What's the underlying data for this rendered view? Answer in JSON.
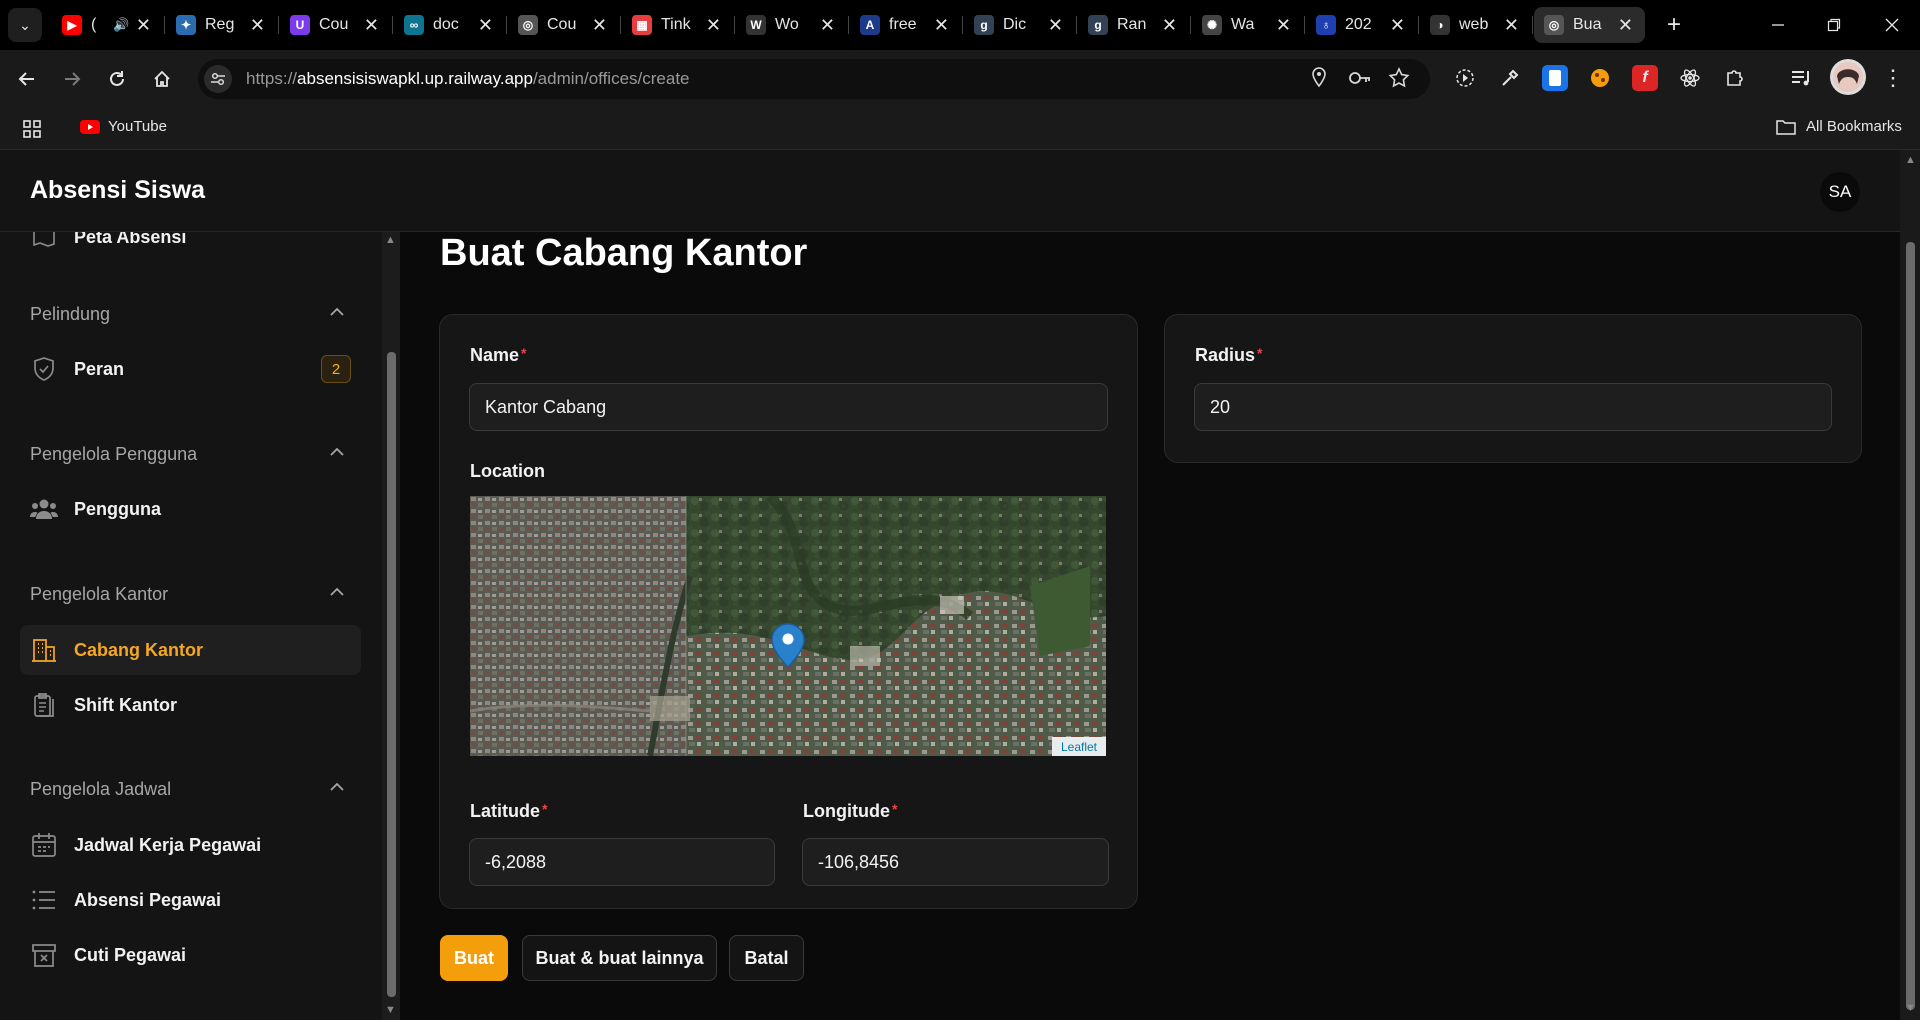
{
  "browser": {
    "tabs": [
      {
        "title": "(",
        "favicon": "youtube-icon",
        "color": "#ff0000",
        "glyph": "▶",
        "muted_audio": true
      },
      {
        "title": "Reg",
        "favicon": "puzzle-icon",
        "color": "#2b6cb0",
        "glyph": "✦"
      },
      {
        "title": "Cou",
        "favicon": "u-icon",
        "color": "#7c3aed",
        "glyph": "U"
      },
      {
        "title": "doc",
        "favicon": "infinity-icon",
        "color": "#0e7490",
        "glyph": "∞"
      },
      {
        "title": "Cou",
        "favicon": "globe-icon",
        "color": "#555555",
        "glyph": "◎"
      },
      {
        "title": "Tink",
        "favicon": "tinkercad-icon",
        "color": "#e53e3e",
        "glyph": "▦"
      },
      {
        "title": "Wo",
        "favicon": "w-icon",
        "color": "#333333",
        "glyph": "W"
      },
      {
        "title": "free",
        "favicon": "a-icon",
        "color": "#1e3a8a",
        "glyph": "A"
      },
      {
        "title": "Dic",
        "favicon": "g-icon",
        "color": "#334155",
        "glyph": "g"
      },
      {
        "title": "Ran",
        "favicon": "g-icon",
        "color": "#334155",
        "glyph": "g"
      },
      {
        "title": "Wa",
        "favicon": "openai-icon",
        "color": "#444444",
        "glyph": "✺"
      },
      {
        "title": "202",
        "favicon": "location-icon",
        "color": "#1e40af",
        "glyph": "♁"
      },
      {
        "title": "web",
        "favicon": "web-icon",
        "color": "#333333",
        "glyph": "◑"
      },
      {
        "title": "Bua",
        "favicon": "globe-icon",
        "color": "#555555",
        "glyph": "◎",
        "active": true
      }
    ],
    "close_glyph": "✕",
    "new_tab": "+",
    "url_prefix": "https://",
    "url_host": "absensisiswapkl.up.railway.app",
    "url_path": "/admin/offices/create",
    "bookmarks": [
      {
        "label": "YouTube",
        "icon": "youtube-icon"
      }
    ],
    "all_bookmarks": "All Bookmarks"
  },
  "app": {
    "brand": "Absensi Siswa",
    "user_initials": "SA"
  },
  "sidebar": {
    "partial_item": "Peta Absensi",
    "groups": [
      {
        "label": "Pelindung",
        "items": [
          {
            "label": "Peran",
            "icon": "shield-check-icon",
            "badge": "2"
          }
        ]
      },
      {
        "label": "Pengelola Pengguna",
        "items": [
          {
            "label": "Pengguna",
            "icon": "users-icon"
          }
        ]
      },
      {
        "label": "Pengelola Kantor",
        "items": [
          {
            "label": "Cabang Kantor",
            "icon": "building-icon",
            "active": true
          },
          {
            "label": "Shift Kantor",
            "icon": "clipboard-icon"
          }
        ]
      },
      {
        "label": "Pengelola Jadwal",
        "items": [
          {
            "label": "Jadwal Kerja Pegawai",
            "icon": "calendar-icon"
          },
          {
            "label": "Absensi Pegawai",
            "icon": "list-icon"
          },
          {
            "label": "Cuti Pegawai",
            "icon": "archive-x-icon"
          }
        ]
      }
    ]
  },
  "form": {
    "title": "Buat Cabang Kantor",
    "name_label": "Name",
    "name_value": "Kantor Cabang",
    "location_label": "Location",
    "map_attribution": "Leaflet",
    "latitude_label": "Latitude",
    "latitude_value": "-6,2088",
    "longitude_label": "Longitude",
    "longitude_value": "-106,8456",
    "radius_label": "Radius",
    "radius_value": "20",
    "required_mark": "*",
    "buttons": {
      "create": "Buat",
      "create_another": "Buat & buat lainnya",
      "cancel": "Batal"
    }
  },
  "colors": {
    "accent": "#f59e0b",
    "required": "#ef4444",
    "badge_text": "#f5b50a"
  }
}
